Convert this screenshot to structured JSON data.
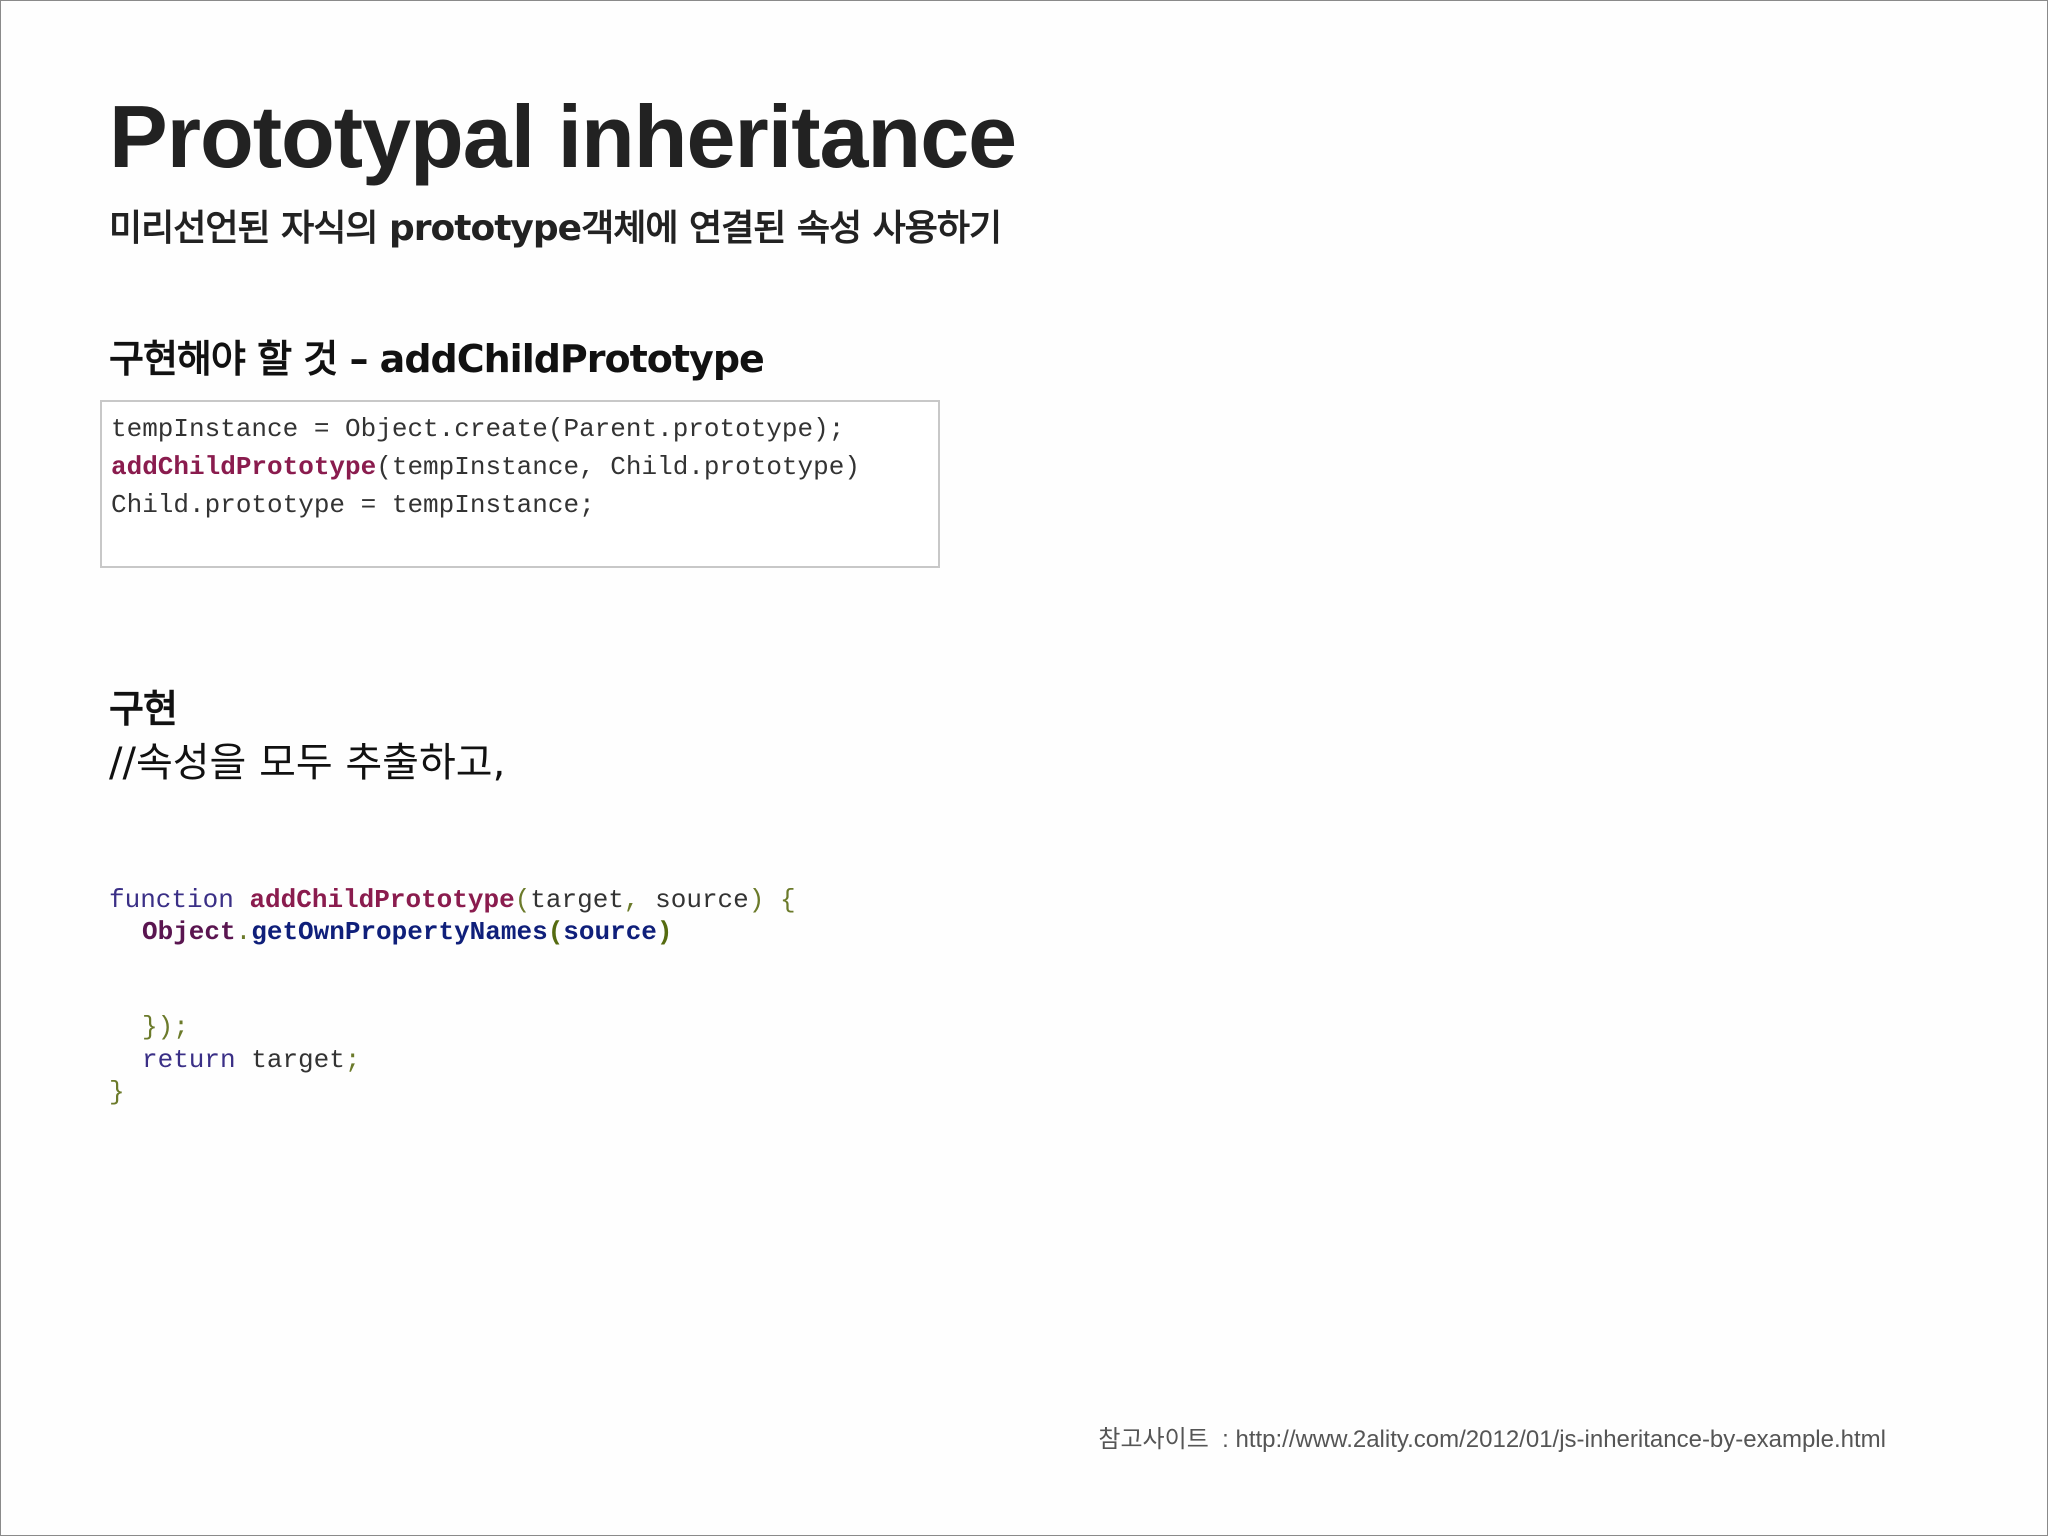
{
  "title": "Prototypal inheritance",
  "subtitle": "미리선언된 자식의 prototype객체에 연결된 속성 사용하기",
  "todo_heading": "구현해야 할 것 – addChildPrototype",
  "todo_code": {
    "line1": "tempInstance = Object.create(Parent.prototype);",
    "line2_fn": "addChildPrototype",
    "line2_rest": "(tempInstance, Child.prototype)",
    "line3": "Child.prototype = tempInstance;"
  },
  "impl_heading": "구현",
  "impl_comment": "//속성을 모두 추출하고,",
  "impl_code": {
    "l1_kw": "function",
    "l1_fn": "addChildPrototype",
    "l1_open": "(",
    "l1_arg1": "target",
    "l1_comma": ",",
    "l1_arg2": "source",
    "l1_close": ") {",
    "l2_obj": "Object",
    "l2_dot": ".",
    "l2_method": "getOwnPropertyNames",
    "l2_open": "(",
    "l2_arg": "source",
    "l2_close": ")",
    "l3": "});",
    "l4_kw": "return",
    "l4_val": "target",
    "l4_semi": ";",
    "l5": "}"
  },
  "footer": {
    "label": "참고사이트",
    "separator": ":",
    "url": "http://www.2ality.com/2012/01/js-inheritance-by-example.html"
  }
}
